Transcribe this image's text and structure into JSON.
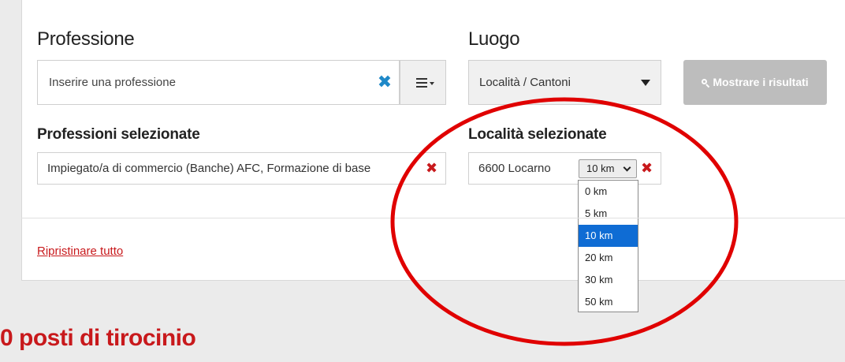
{
  "profession": {
    "heading": "Professione",
    "input_placeholder": "Inserire una professione",
    "input_value": "",
    "clear_icon": "✖",
    "list_icon": "list-menu-icon"
  },
  "location": {
    "heading": "Luogo",
    "select_value": "Località / Cantoni"
  },
  "show_results_label": "Mostrare i risultati",
  "selected_professions": {
    "heading": "Professioni selezionate",
    "items": [
      {
        "label": "Impiegato/a di commercio (Banche) AFC, Formazione di base"
      }
    ],
    "remove_icon": "✖"
  },
  "selected_locations": {
    "heading": "Località selezionate",
    "items": [
      {
        "label": "6600 Locarno",
        "radius": "10 km"
      }
    ],
    "remove_icon": "✖"
  },
  "radius_options": [
    "0 km",
    "5 km",
    "10 km",
    "20 km",
    "30 km",
    "50 km"
  ],
  "radius_selected": "10 km",
  "reset_label": "Ripristinare tutto",
  "result_count": "0 posti di tirocinio",
  "colors": {
    "accent_red": "#c8191c",
    "clear_blue": "#1e88c8",
    "selected_option": "#0f6cd4",
    "disabled_button": "#bdbdbd",
    "annotation_circle": "#e00000"
  }
}
